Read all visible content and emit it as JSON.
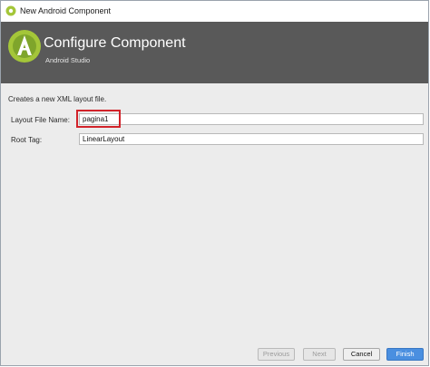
{
  "window": {
    "title": "New Android Component"
  },
  "banner": {
    "title": "Configure Component",
    "subtitle": "Android Studio"
  },
  "form": {
    "description": "Creates a new XML layout file.",
    "layout_file_name_label": "Layout File Name:",
    "layout_file_name_value": "pagina1",
    "root_tag_label": "Root Tag:",
    "root_tag_value": "LinearLayout"
  },
  "buttons": {
    "previous": "Previous",
    "next": "Next",
    "cancel": "Cancel",
    "finish": "Finish"
  },
  "colors": {
    "banner": "#595959",
    "highlight": "#d2232a",
    "primary_button": "#4a8fe0",
    "android_green": "#a4c639"
  },
  "icons": {
    "title": "android-studio-icon",
    "logo": "android-studio-logo-icon"
  }
}
